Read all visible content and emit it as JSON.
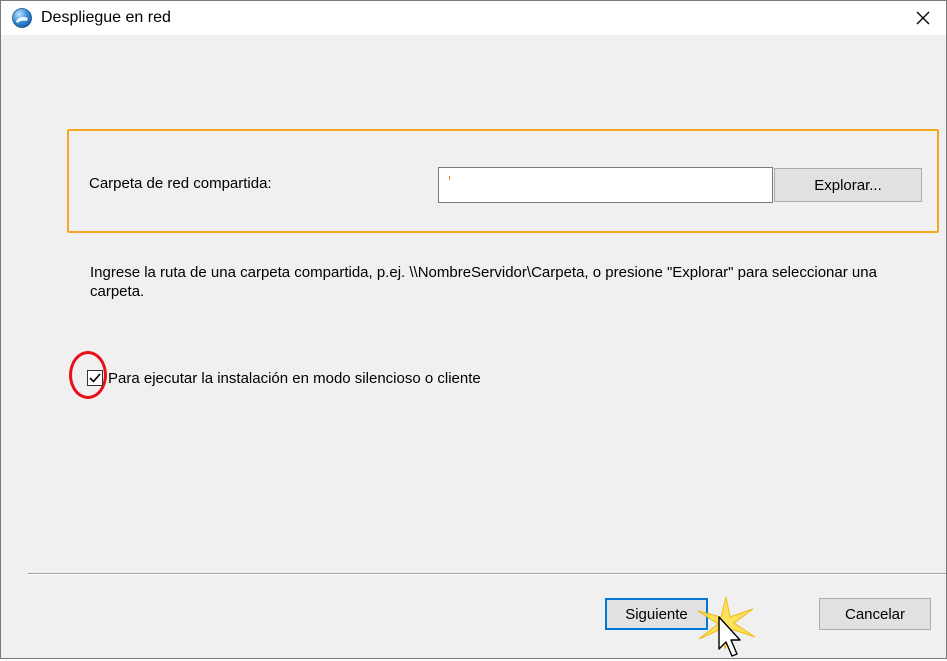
{
  "window": {
    "title": "Despliegue en red",
    "app_icon": "globe-app-icon",
    "close_glyph": "✕"
  },
  "form": {
    "folder_label": "Carpeta de red compartida:",
    "folder_value": "",
    "browse_label": "Explorar...",
    "hint": "Ingrese la ruta de una carpeta compartida, p.ej. \\\\NombreServidor\\Carpeta, o presione \"Explorar\" para seleccionar una carpeta.",
    "silent_checkbox": {
      "checked": true,
      "label": "Para ejecutar la instalación en modo silencioso o cliente"
    }
  },
  "buttons": {
    "next_label": "Siguiente",
    "cancel_label": "Cancelar"
  },
  "colors": {
    "highlight_box": "#f5a623",
    "annotation_circle": "#e8101a",
    "focus_border": "#0078d7"
  }
}
